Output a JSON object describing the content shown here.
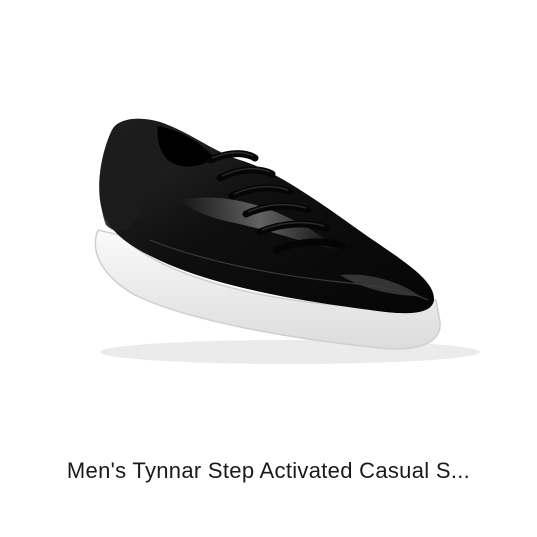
{
  "product": {
    "image_alt": "black leather sneaker",
    "title": "Men's Tynnar Step Activated Casual S..."
  },
  "colors": {
    "shoe_upper": "#111111",
    "sole": "#f4f4f4",
    "background": "#ffffff",
    "title_text": "#1a1a1a"
  }
}
